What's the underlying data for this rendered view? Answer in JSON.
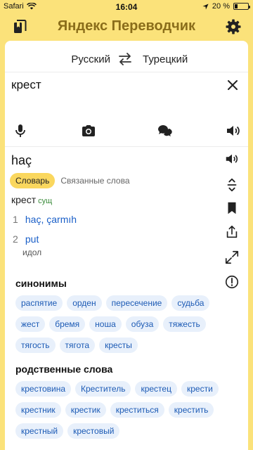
{
  "statusbar": {
    "carrier": "Safari",
    "time": "16:04",
    "battery": "20 %",
    "battery_level": 0.2
  },
  "appbar": {
    "title": "Яндекс Переводчик"
  },
  "languages": {
    "source": "Русский",
    "target": "Турецкий"
  },
  "input": {
    "text": "крест"
  },
  "result": {
    "word": "haç"
  },
  "tabs": {
    "dictionary": "Словарь",
    "related": "Связанные слова"
  },
  "entry": {
    "headword": "крест",
    "pos": "сущ",
    "senses": [
      {
        "num": "1",
        "translation": "haç, çarmıh",
        "gloss": ""
      },
      {
        "num": "2",
        "translation": "put",
        "gloss": "идол"
      }
    ]
  },
  "synonyms": {
    "title": "синонимы",
    "items": [
      "распятие",
      "орден",
      "пересечение",
      "судьба",
      "жест",
      "бремя",
      "ноша",
      "обуза",
      "тяжесть",
      "тягость",
      "тягота",
      "кресты"
    ]
  },
  "related": {
    "title": "родственные слова",
    "items": [
      "крестовина",
      "Креститель",
      "крестец",
      "крести",
      "крестник",
      "крестик",
      "креститься",
      "крестить",
      "крестный",
      "крестовый"
    ]
  },
  "colors": {
    "accent": "#fbe27a",
    "link": "#1a5fc8",
    "chip_bg": "#e8f0fb"
  }
}
